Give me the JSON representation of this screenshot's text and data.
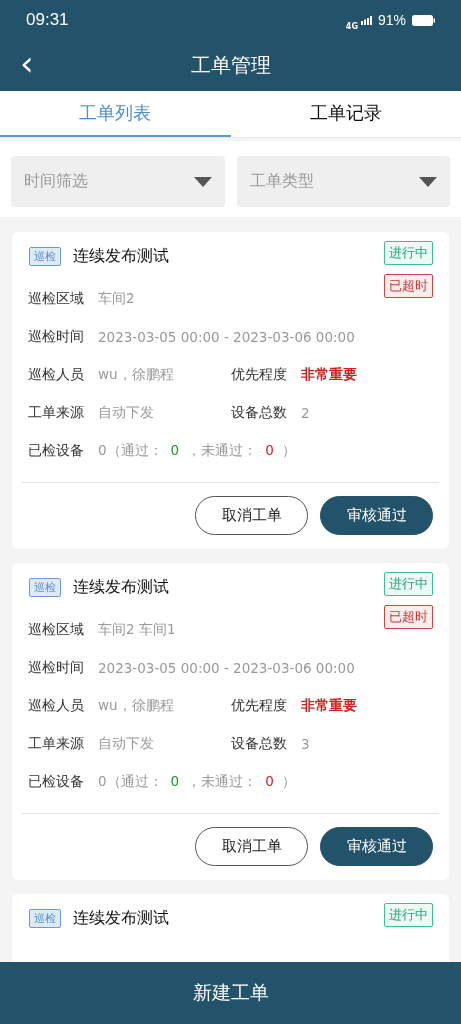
{
  "status_bar": {
    "time": "09:31",
    "network": "4G",
    "battery": "91%"
  },
  "header": {
    "back": "‹",
    "title": "工单管理"
  },
  "tabs": [
    {
      "label": "工单列表",
      "selected": true
    },
    {
      "label": "工单记录",
      "selected": false
    }
  ],
  "filters": [
    {
      "placeholder": "时间筛选"
    },
    {
      "placeholder": "工单类型"
    }
  ],
  "cards": [
    {
      "tag": "巡检",
      "title": "连续发布测试",
      "statuses": [
        {
          "text": "进行中",
          "kind": "progress"
        },
        {
          "text": "已超时",
          "kind": "overdue"
        }
      ],
      "rows": [
        [
          {
            "label": "巡检区域",
            "parts": [
              {
                "text": "车间2",
                "kind": "plain"
              }
            ]
          }
        ],
        [
          {
            "label": "巡检时间",
            "parts": [
              {
                "text": "2023-03-05 00:00 - 2023-03-06 00:00",
                "kind": "plain"
              }
            ]
          }
        ],
        [
          {
            "label": "巡检人员",
            "parts": [
              {
                "text": "wu，徐鹏程",
                "kind": "plain"
              }
            ]
          },
          {
            "label": "优先程度",
            "parts": [
              {
                "text": "非常重要",
                "kind": "alert"
              }
            ]
          }
        ],
        [
          {
            "label": "工单来源",
            "parts": [
              {
                "text": "自动下发",
                "kind": "plain"
              }
            ]
          },
          {
            "label": "设备总数",
            "parts": [
              {
                "text": "2",
                "kind": "plain"
              }
            ]
          }
        ],
        [
          {
            "label": "已检设备",
            "parts": [
              {
                "text": "0（通过：",
                "kind": "plain"
              },
              {
                "text": "0",
                "kind": "pass"
              },
              {
                "text": "，未通过：",
                "kind": "plain"
              },
              {
                "text": "0",
                "kind": "fail"
              },
              {
                "text": "）",
                "kind": "plain"
              }
            ]
          }
        ]
      ],
      "buttons": [
        {
          "label": "取消工单",
          "kind": "outline"
        },
        {
          "label": "审核通过",
          "kind": "primary"
        }
      ]
    },
    {
      "tag": "巡检",
      "title": "连续发布测试",
      "statuses": [
        {
          "text": "进行中",
          "kind": "progress"
        },
        {
          "text": "已超时",
          "kind": "overdue"
        }
      ],
      "rows": [
        [
          {
            "label": "巡检区域",
            "parts": [
              {
                "text": "车间2 车间1",
                "kind": "plain"
              }
            ]
          }
        ],
        [
          {
            "label": "巡检时间",
            "parts": [
              {
                "text": "2023-03-05 00:00 - 2023-03-06 00:00",
                "kind": "plain"
              }
            ]
          }
        ],
        [
          {
            "label": "巡检人员",
            "parts": [
              {
                "text": "wu，徐鹏程",
                "kind": "plain"
              }
            ]
          },
          {
            "label": "优先程度",
            "parts": [
              {
                "text": "非常重要",
                "kind": "alert"
              }
            ]
          }
        ],
        [
          {
            "label": "工单来源",
            "parts": [
              {
                "text": "自动下发",
                "kind": "plain"
              }
            ]
          },
          {
            "label": "设备总数",
            "parts": [
              {
                "text": "3",
                "kind": "plain"
              }
            ]
          }
        ],
        [
          {
            "label": "已检设备",
            "parts": [
              {
                "text": "0（通过：",
                "kind": "plain"
              },
              {
                "text": "0",
                "kind": "pass"
              },
              {
                "text": "，未通过：",
                "kind": "plain"
              },
              {
                "text": "0",
                "kind": "fail"
              },
              {
                "text": "）",
                "kind": "plain"
              }
            ]
          }
        ]
      ],
      "buttons": [
        {
          "label": "取消工单",
          "kind": "outline"
        },
        {
          "label": "审核通过",
          "kind": "primary"
        }
      ]
    },
    {
      "tag": "巡检",
      "title": "连续发布测试",
      "statuses": [
        {
          "text": "进行中",
          "kind": "progress"
        }
      ]
    }
  ],
  "bottom_button": {
    "label": "新建工单"
  }
}
